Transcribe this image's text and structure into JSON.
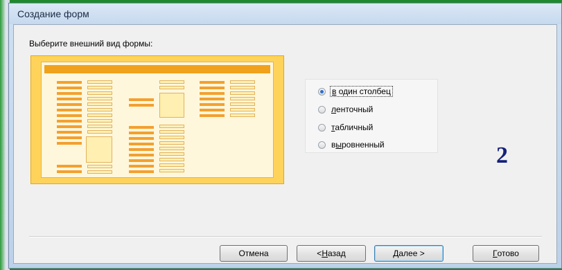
{
  "window": {
    "title": "Создание форм"
  },
  "prompt": "Выберите внешний вид формы:",
  "layout_options": [
    {
      "label_prefix": "",
      "accel": "в",
      "label_rest": " один столбец",
      "checked": true
    },
    {
      "label_prefix": "",
      "accel": "л",
      "label_rest": "енточный",
      "checked": false
    },
    {
      "label_prefix": "",
      "accel": "т",
      "label_rest": "абличный",
      "checked": false
    },
    {
      "label_prefix": "в",
      "accel": "ы",
      "label_rest": "ровненный",
      "checked": false
    }
  ],
  "annotation": "2",
  "buttons": {
    "cancel": {
      "label": "Отмена"
    },
    "back": {
      "prefix": "< ",
      "accel": "Н",
      "rest": "азад"
    },
    "next": {
      "prefix": "",
      "accel": "Д",
      "rest": "алее >"
    },
    "finish": {
      "prefix": "",
      "accel": "Г",
      "rest": "отово"
    }
  },
  "colors": {
    "preview_border": "#ffd35a",
    "preview_header": "#f0a21c",
    "annotation": "#15207a"
  }
}
